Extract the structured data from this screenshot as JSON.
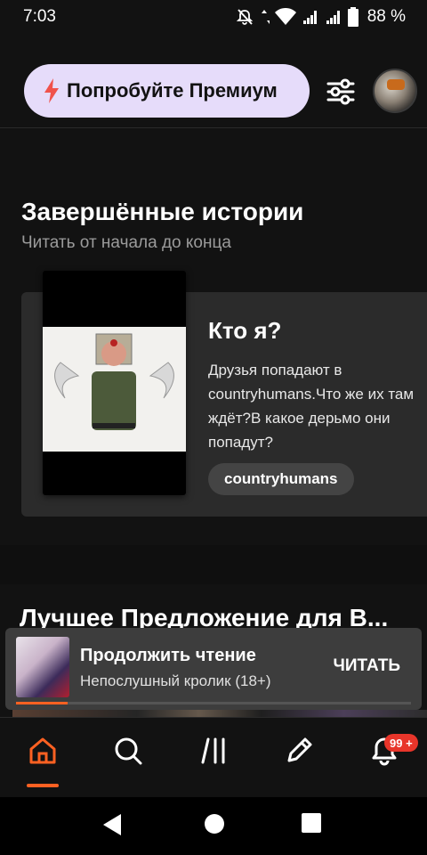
{
  "status_bar": {
    "time": "7:03",
    "battery": "88 %",
    "icons": [
      "notifications-off-icon",
      "data-arrows-icon",
      "wifi-icon",
      "signal-icon",
      "signal-icon",
      "battery-icon"
    ]
  },
  "header": {
    "premium_label": "Попробуйте Премиум",
    "premium_icon": "bolt-icon",
    "filter_icon": "sliders-icon",
    "avatar_icon": "user-avatar"
  },
  "completed_section": {
    "title": "Завершённые истории",
    "subtitle": "Читать от начала до конца",
    "story": {
      "title": "Кто я?",
      "description": "Друзья попадают в countryhumans.Что же их там ждёт?В какое дерьмо они попадут?",
      "tag": "countryhumans"
    }
  },
  "second_section": {
    "title": "Лучшее Предложение для В..."
  },
  "continue_reading": {
    "title": "Продолжить чтение",
    "story_name": "Непослушный кролик (18+)",
    "action_label": "ЧИТАТЬ",
    "progress": 0.13
  },
  "bottom_nav": {
    "items": [
      "home-icon",
      "search-icon",
      "library-icon",
      "write-icon",
      "notifications-icon"
    ],
    "active": "home",
    "notifications_badge": "99 +"
  },
  "colors": {
    "accent": "#ff6122",
    "premium_bg": "#e6dcfa",
    "premium_bolt": "#f0524b",
    "badge": "#e8352a",
    "card_bg": "#2b2b2b"
  }
}
